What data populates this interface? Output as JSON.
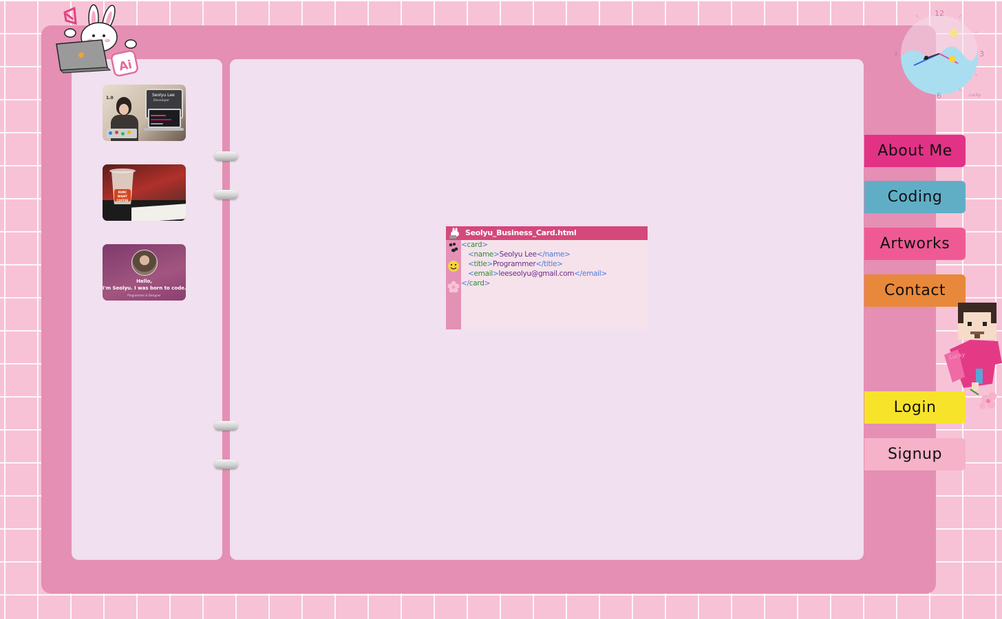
{
  "nav": {
    "about_label": "About Me",
    "coding_label": "Coding",
    "artworks_label": "Artworks",
    "contact_label": "Contact",
    "login_label": "Login",
    "signup_label": "Signup"
  },
  "colors": {
    "background": "#f7c2d6",
    "binder": "#e48fb3",
    "page": "#f1e0ef",
    "about": "#e23286",
    "coding": "#60aec6",
    "artworks": "#ef5a95",
    "contact": "#e8883a",
    "login": "#f7e42a",
    "signup": "#f6b2c8"
  },
  "clock": {
    "numbers": [
      "12",
      "3",
      "6",
      "9"
    ],
    "label": "Lucky"
  },
  "mascots": {
    "bunny_badge": "Ai",
    "pixel_guy_shirt": "Lucky"
  },
  "thumbnails": [
    {
      "name": "Seolyu Lee",
      "role": "Developer",
      "badge": "1.0"
    },
    {
      "cup_text": "RUNC NIGHT COFFEE"
    },
    {
      "greeting": "Hello,",
      "tagline": "I'm Seolyu. I was born to code.",
      "subtitle": "Programmer & Designer"
    }
  ],
  "code_window": {
    "title": "Seolyu_Business_Card.html",
    "lines": [
      {
        "open": "<",
        "tag": "card",
        "close": ">",
        "value": "",
        "etag": ""
      },
      {
        "open": "<",
        "tag": "name",
        "close": ">",
        "value": "Seolyu Lee",
        "etag": "</name>"
      },
      {
        "open": "<",
        "tag": "title",
        "close": ">",
        "value": "Programmer",
        "etag": "</title>"
      },
      {
        "open": "<",
        "tag": "email",
        "close": ">",
        "value": "leeseolyu@gmail.com",
        "etag": "</email>"
      },
      {
        "open": "</",
        "tag": "card",
        "close": ">",
        "value": "",
        "etag": ""
      }
    ]
  }
}
